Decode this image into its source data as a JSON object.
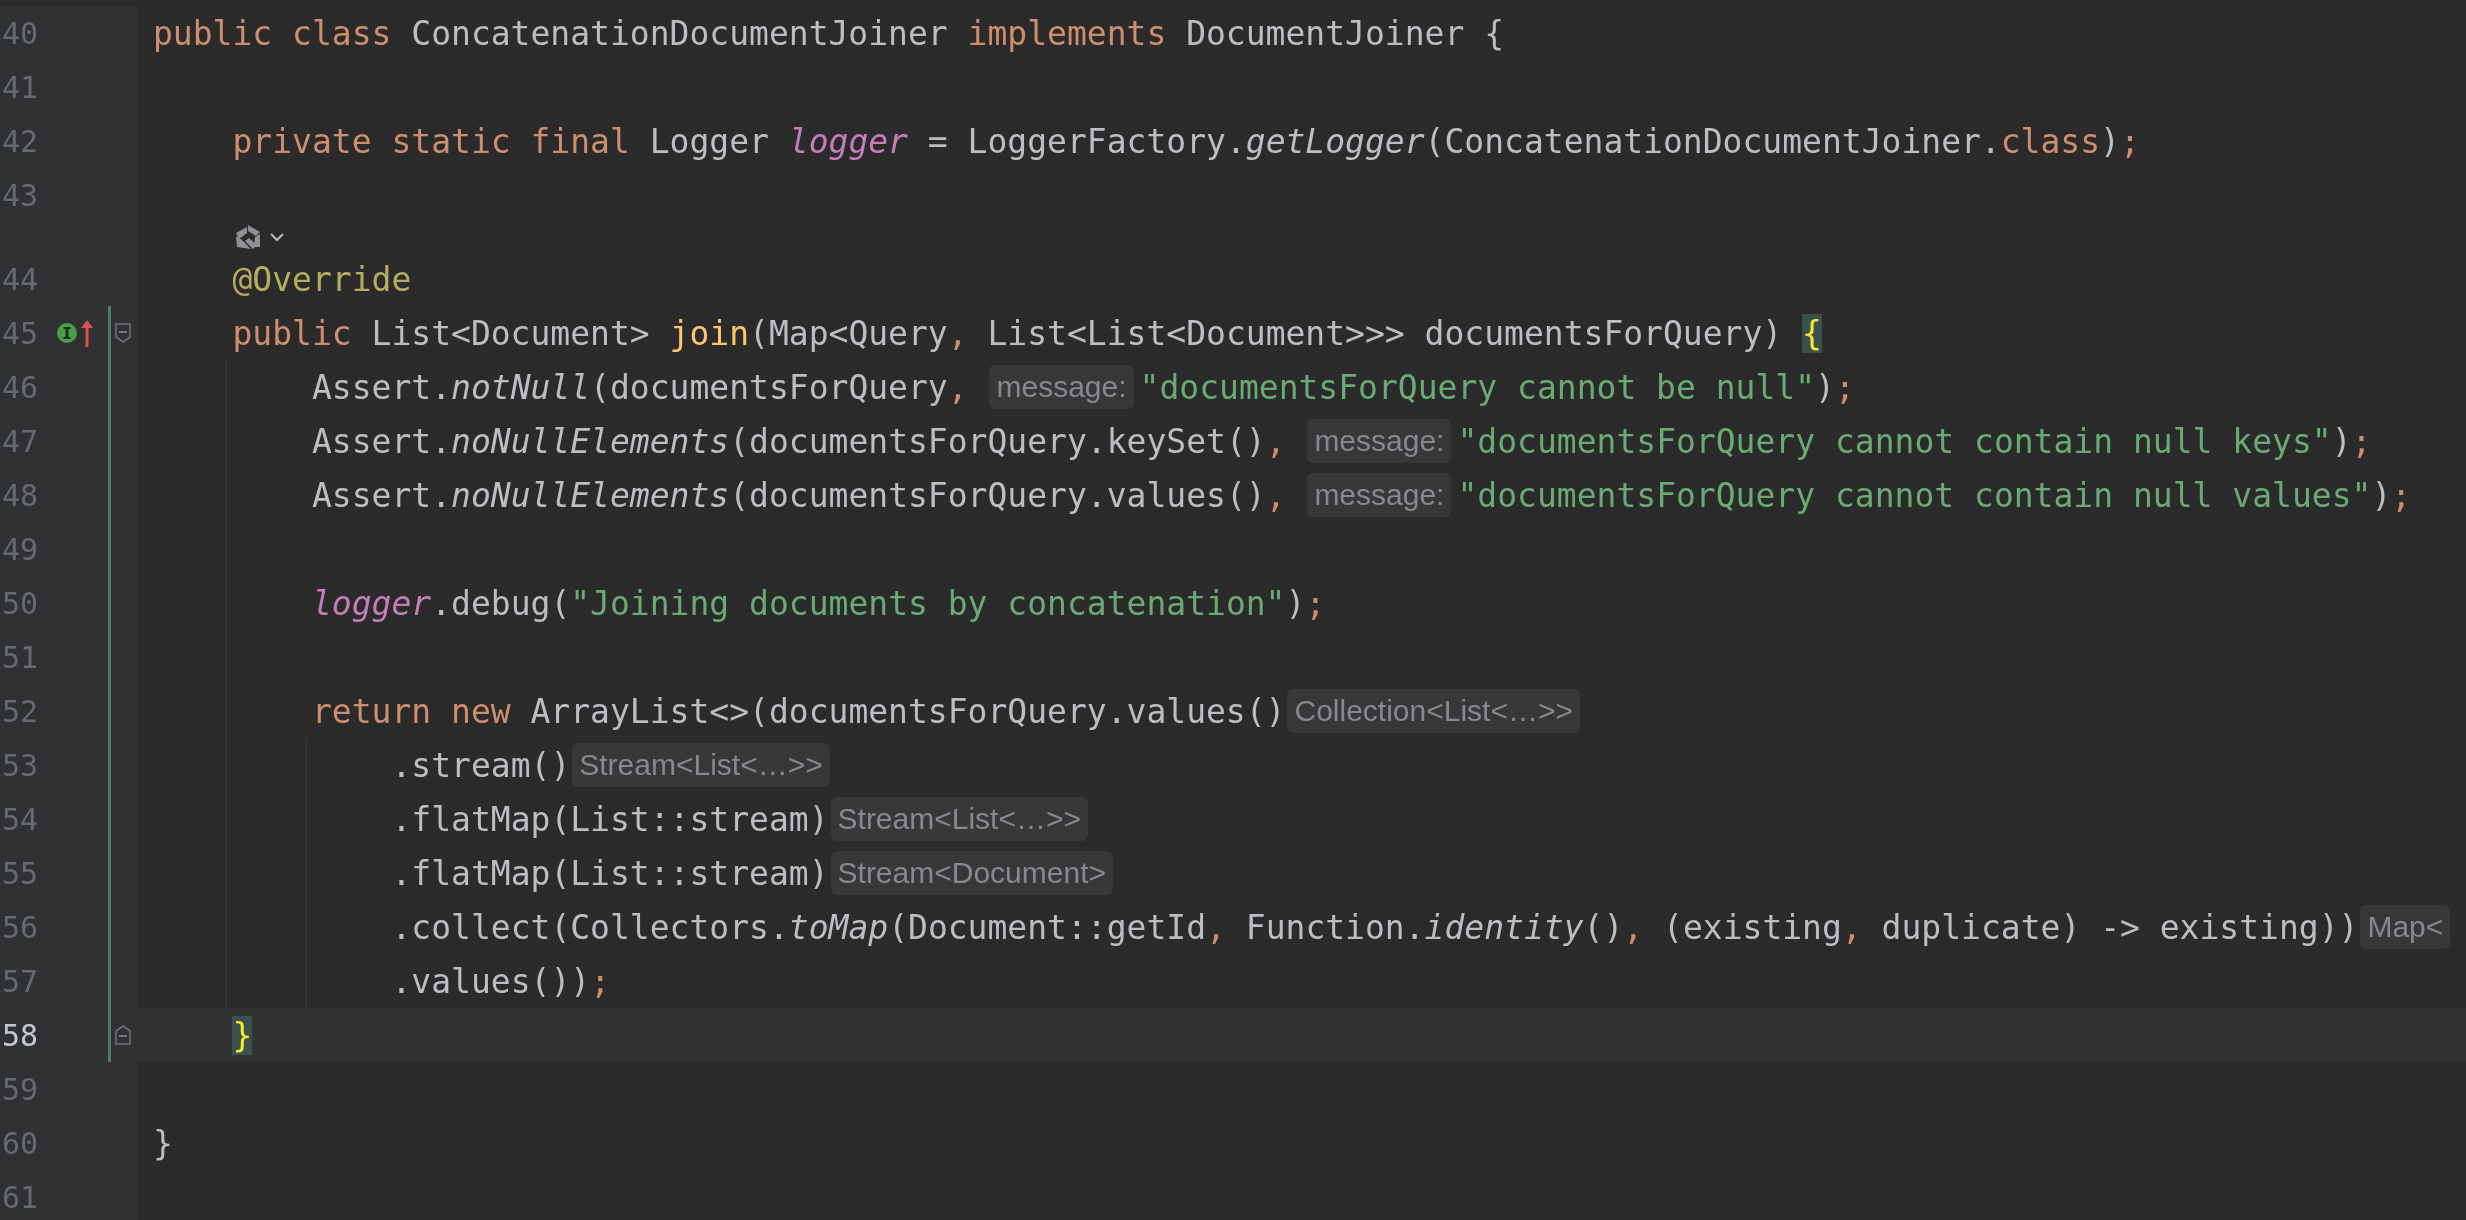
{
  "editor": {
    "lines": [
      {
        "number": "40",
        "current": false,
        "modified": false,
        "tokens": [
          {
            "text": "public class ",
            "kind": "kw"
          },
          {
            "text": "ConcatenationDocumentJoiner ",
            "kind": "plain"
          },
          {
            "text": "implements ",
            "kind": "kw"
          },
          {
            "text": "DocumentJoiner {",
            "kind": "plain"
          }
        ],
        "children": [
          {
            "number": "41",
            "current": false,
            "modified": false
          },
          {
            "number": "42",
            "current": false,
            "modified": false,
            "tokens": [
              {
                "text": "private static final ",
                "kind": "kw"
              },
              {
                "text": "Logger ",
                "kind": "plain"
              },
              {
                "text": "logger",
                "kind": "field"
              },
              {
                "text": " = LoggerFactory.",
                "kind": "plain"
              },
              {
                "text": "getLogger",
                "kind": "static"
              },
              {
                "text": "(ConcatenationDocumentJoiner.",
                "kind": "plain"
              },
              {
                "text": "class",
                "kind": "kw"
              },
              {
                "text": ")",
                "kind": "plain"
              },
              {
                "text": ";",
                "kind": "punct"
              }
            ]
          },
          {
            "number": "43",
            "current": false,
            "modified": false,
            "lens": true
          },
          {
            "number": "44",
            "current": false,
            "modified": false,
            "tokens": [
              {
                "text": "@Override",
                "kind": "annotation"
              }
            ]
          },
          {
            "number": "45",
            "current": false,
            "modified": true,
            "fold_start": true,
            "implements_marker": true,
            "overrides_marker": true,
            "tokens": [
              {
                "text": "public ",
                "kind": "kw"
              },
              {
                "text": "List<Document> ",
                "kind": "plain"
              },
              {
                "text": "join",
                "kind": "decl"
              },
              {
                "text": "(Map<Query",
                "kind": "plain"
              },
              {
                "text": ", ",
                "kind": "punct"
              },
              {
                "text": "List<List<Document>>> documentsForQuery) ",
                "kind": "plain"
              },
              {
                "text": "{",
                "kind": "brace"
              }
            ],
            "children": [
              {
                "number": "46",
                "current": false,
                "modified": true,
                "tokens": [
                  {
                    "text": "Assert.",
                    "kind": "plain"
                  },
                  {
                    "text": "notNull",
                    "kind": "static"
                  },
                  {
                    "text": "(documentsForQuery",
                    "kind": "plain"
                  },
                  {
                    "text": ", ",
                    "kind": "punct"
                  },
                  {
                    "text": "message:",
                    "kind": "hint"
                  },
                  {
                    "text": "\"documentsForQuery cannot be null\"",
                    "kind": "string"
                  },
                  {
                    "text": ")",
                    "kind": "plain"
                  },
                  {
                    "text": ";",
                    "kind": "punct"
                  }
                ]
              },
              {
                "number": "47",
                "current": false,
                "modified": true,
                "tokens": [
                  {
                    "text": "Assert.",
                    "kind": "plain"
                  },
                  {
                    "text": "noNullElements",
                    "kind": "static"
                  },
                  {
                    "text": "(documentsForQuery.keySet()",
                    "kind": "plain"
                  },
                  {
                    "text": ", ",
                    "kind": "punct"
                  },
                  {
                    "text": "message:",
                    "kind": "hint"
                  },
                  {
                    "text": "\"documentsForQuery cannot contain null keys\"",
                    "kind": "string"
                  },
                  {
                    "text": ")",
                    "kind": "plain"
                  },
                  {
                    "text": ";",
                    "kind": "punct"
                  }
                ]
              },
              {
                "number": "48",
                "current": false,
                "modified": true,
                "tokens": [
                  {
                    "text": "Assert.",
                    "kind": "plain"
                  },
                  {
                    "text": "noNullElements",
                    "kind": "static"
                  },
                  {
                    "text": "(documentsForQuery.values()",
                    "kind": "plain"
                  },
                  {
                    "text": ", ",
                    "kind": "punct"
                  },
                  {
                    "text": "message:",
                    "kind": "hint"
                  },
                  {
                    "text": "\"documentsForQuery cannot contain null values\"",
                    "kind": "string"
                  },
                  {
                    "text": ")",
                    "kind": "plain"
                  },
                  {
                    "text": ";",
                    "kind": "punct"
                  }
                ]
              },
              {
                "number": "49",
                "current": false,
                "modified": true
              },
              {
                "number": "50",
                "current": false,
                "modified": true,
                "tokens": [
                  {
                    "text": "logger",
                    "kind": "field"
                  },
                  {
                    "text": ".debug(",
                    "kind": "plain"
                  },
                  {
                    "text": "\"Joining documents by concatenation\"",
                    "kind": "string"
                  },
                  {
                    "text": ")",
                    "kind": "plain"
                  },
                  {
                    "text": ";",
                    "kind": "punct"
                  }
                ]
              },
              {
                "number": "51",
                "current": false,
                "modified": true
              },
              {
                "number": "52",
                "current": false,
                "modified": true,
                "tokens": [
                  {
                    "text": "return new ",
                    "kind": "kw"
                  },
                  {
                    "text": "ArrayList<>(documentsForQuery.values()",
                    "kind": "plain"
                  },
                  {
                    "text": "Collection<List<…>>",
                    "kind": "hint"
                  }
                ],
                "children": [
                  {
                    "number": "53",
                    "current": false,
                    "modified": true,
                    "tokens": [
                      {
                        "text": ".stream()",
                        "kind": "plain"
                      },
                      {
                        "text": "Stream<List<…>>",
                        "kind": "hint"
                      }
                    ]
                  },
                  {
                    "number": "54",
                    "current": false,
                    "modified": true,
                    "tokens": [
                      {
                        "text": ".flatMap(List::stream)",
                        "kind": "plain"
                      },
                      {
                        "text": "Stream<List<…>>",
                        "kind": "hint"
                      }
                    ]
                  },
                  {
                    "number": "55",
                    "current": false,
                    "modified": true,
                    "tokens": [
                      {
                        "text": ".flatMap(List::stream)",
                        "kind": "plain"
                      },
                      {
                        "text": "Stream<Document>",
                        "kind": "hint"
                      }
                    ]
                  },
                  {
                    "number": "56",
                    "current": false,
                    "modified": true,
                    "tokens": [
                      {
                        "text": ".collect(Collectors.",
                        "kind": "plain"
                      },
                      {
                        "text": "toMap",
                        "kind": "static"
                      },
                      {
                        "text": "(Document::getId",
                        "kind": "plain"
                      },
                      {
                        "text": ", ",
                        "kind": "punct"
                      },
                      {
                        "text": "Function.",
                        "kind": "plain"
                      },
                      {
                        "text": "identity",
                        "kind": "static"
                      },
                      {
                        "text": "()",
                        "kind": "plain"
                      },
                      {
                        "text": ", ",
                        "kind": "punct"
                      },
                      {
                        "text": "(existing",
                        "kind": "plain"
                      },
                      {
                        "text": ", ",
                        "kind": "punct"
                      },
                      {
                        "text": "duplicate) -> existing))",
                        "kind": "plain"
                      },
                      {
                        "text": "Map<",
                        "kind": "hint"
                      }
                    ]
                  },
                  {
                    "number": "57",
                    "current": false,
                    "modified": true,
                    "tokens": [
                      {
                        "text": ".values())",
                        "kind": "plain"
                      },
                      {
                        "text": ";",
                        "kind": "punct"
                      }
                    ]
                  }
                ]
              }
            ]
          },
          {
            "number": "58",
            "current": true,
            "modified": true,
            "fold_end": true,
            "tokens": [
              {
                "text": "}",
                "kind": "brace"
              }
            ]
          },
          {
            "number": "59",
            "current": false,
            "modified": false
          }
        ]
      },
      {
        "number": "60",
        "current": false,
        "modified": false,
        "tokens": [
          {
            "text": "}",
            "kind": "plain"
          }
        ]
      },
      {
        "number": "61",
        "current": false,
        "modified": false
      }
    ]
  }
}
